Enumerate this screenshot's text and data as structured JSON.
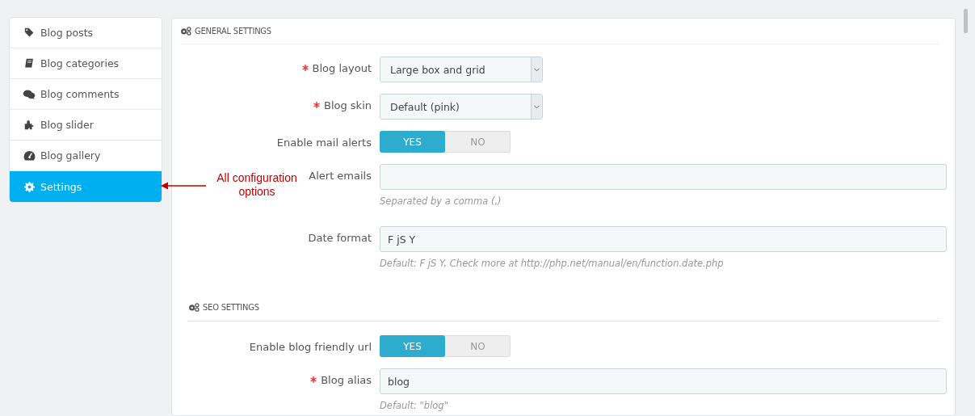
{
  "sidebar": {
    "items": [
      {
        "label": "Blog posts",
        "selected": false
      },
      {
        "label": "Blog categories",
        "selected": false
      },
      {
        "label": "Blog comments",
        "selected": false
      },
      {
        "label": "Blog slider",
        "selected": false
      },
      {
        "label": "Blog gallery",
        "selected": false
      },
      {
        "label": "Settings",
        "selected": true
      }
    ]
  },
  "annotation": {
    "text": "All configuration options"
  },
  "sections": [
    {
      "title": "GENERAL SETTINGS",
      "fields": [
        {
          "kind": "select",
          "label": "Blog layout",
          "required": true,
          "value": "Large box and grid"
        },
        {
          "kind": "select",
          "label": "Blog skin",
          "required": true,
          "value": "Default (pink)"
        },
        {
          "kind": "switch",
          "label": "Enable mail alerts",
          "required": false,
          "on": true,
          "yes": "YES",
          "no": "NO"
        },
        {
          "kind": "text",
          "label": "Alert emails",
          "required": false,
          "help": "Separated by a comma (,)"
        },
        {
          "kind": "text",
          "label": "Date format",
          "required": false,
          "value": "F jS Y",
          "help": "Default: F jS Y, Check more at http://php.net/manual/en/function.date.php"
        }
      ]
    },
    {
      "title": "SEO SETTINGS",
      "fields": [
        {
          "kind": "switch",
          "label": "Enable blog friendly url",
          "required": false,
          "on": true,
          "yes": "YES",
          "no": "NO"
        },
        {
          "kind": "text",
          "label": "Blog alias",
          "required": true,
          "value": "blog",
          "help": "Default: \"blog\""
        }
      ]
    }
  ]
}
